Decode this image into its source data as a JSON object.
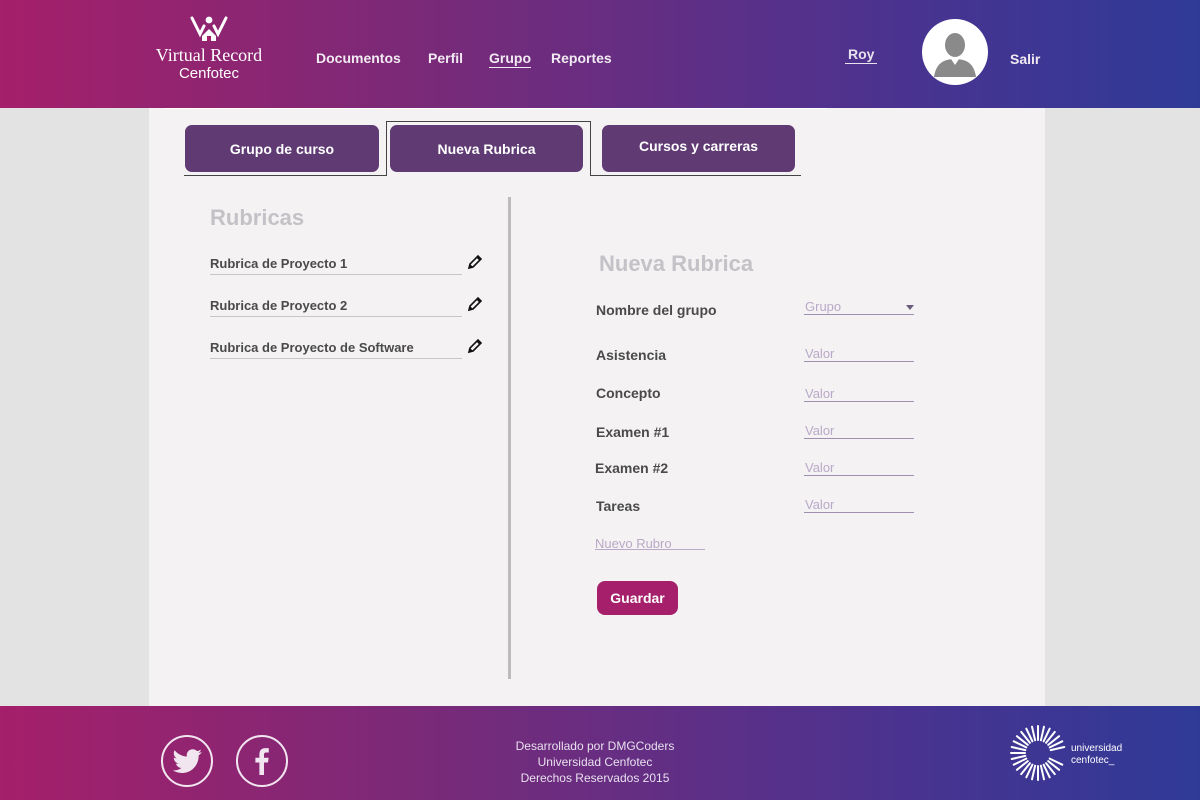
{
  "header": {
    "logo_line1": "Virtual Record",
    "logo_line2": "Cenfotec",
    "nav": [
      "Documentos",
      "Perfil",
      "Grupo",
      "Reportes"
    ],
    "active_nav": "Grupo",
    "user_name": "Roy",
    "logout_label": "Salir",
    "avatar_icon": "user-silhouette-icon"
  },
  "tabs": [
    "Grupo de curso",
    "Nueva Rubrica",
    "Cursos y carreras"
  ],
  "active_tab": "Nueva Rubrica",
  "sidebar": {
    "title": "Rubricas",
    "items": [
      {
        "label": "Rubrica de Proyecto 1",
        "icon": "pencil-icon"
      },
      {
        "label": "Rubrica de Proyecto 2",
        "icon": "pencil-icon"
      },
      {
        "label": "Rubrica de Proyecto de Software",
        "icon": "pencil-icon"
      }
    ]
  },
  "form": {
    "title": "Nueva Rubrica",
    "group_label": "Nombre del grupo",
    "group_placeholder": "Grupo",
    "fields": [
      {
        "label": "Asistencia",
        "placeholder": "Valor"
      },
      {
        "label": "Concepto",
        "placeholder": "Valor"
      },
      {
        "label": "Examen #1",
        "placeholder": "Valor"
      },
      {
        "label": "Examen #2",
        "placeholder": "Valor"
      },
      {
        "label": "Tareas",
        "placeholder": "Valor"
      }
    ],
    "new_rubro_label": "Nuevo Rubro",
    "save_label": "Guardar"
  },
  "footer": {
    "credits": [
      "Desarrollado por DMGCoders",
      "Universidad Cenfotec",
      "Derechos Reservados 2015"
    ],
    "uni_logo_line1": "universidad",
    "uni_logo_line2": "cenfotec_",
    "social": [
      "twitter-icon",
      "facebook-icon"
    ]
  },
  "colors": {
    "brand_magenta": "#a51f6a",
    "brand_blue": "#2f3a97",
    "tab_purple": "#5f3a73",
    "placeholder": "#b9a9c8"
  }
}
